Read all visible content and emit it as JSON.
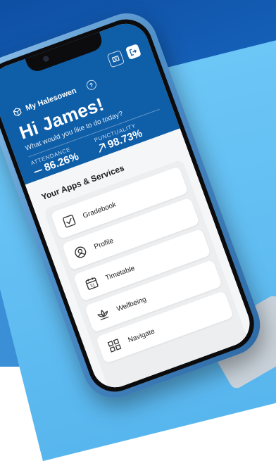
{
  "header": {
    "brand": "My Halesowen",
    "help_icon": "?",
    "greeting": "Hi James!",
    "subtitle": "What would you like to do today?"
  },
  "stats": {
    "attendance": {
      "label": "ATTENDANCE",
      "value": "86.26%"
    },
    "punctuality": {
      "label": "PUNCTUALITY",
      "value": "98.73%"
    }
  },
  "apps": {
    "title": "Your Apps & Services",
    "items": [
      {
        "label": "Gradebook",
        "icon": "gradebook-icon"
      },
      {
        "label": "Profile",
        "icon": "profile-icon"
      },
      {
        "label": "Timetable",
        "icon": "calendar-icon"
      },
      {
        "label": "Wellbeing",
        "icon": "lotus-icon"
      },
      {
        "label": "Navigate",
        "icon": "grid-icon"
      }
    ]
  },
  "calendar_day": "31"
}
